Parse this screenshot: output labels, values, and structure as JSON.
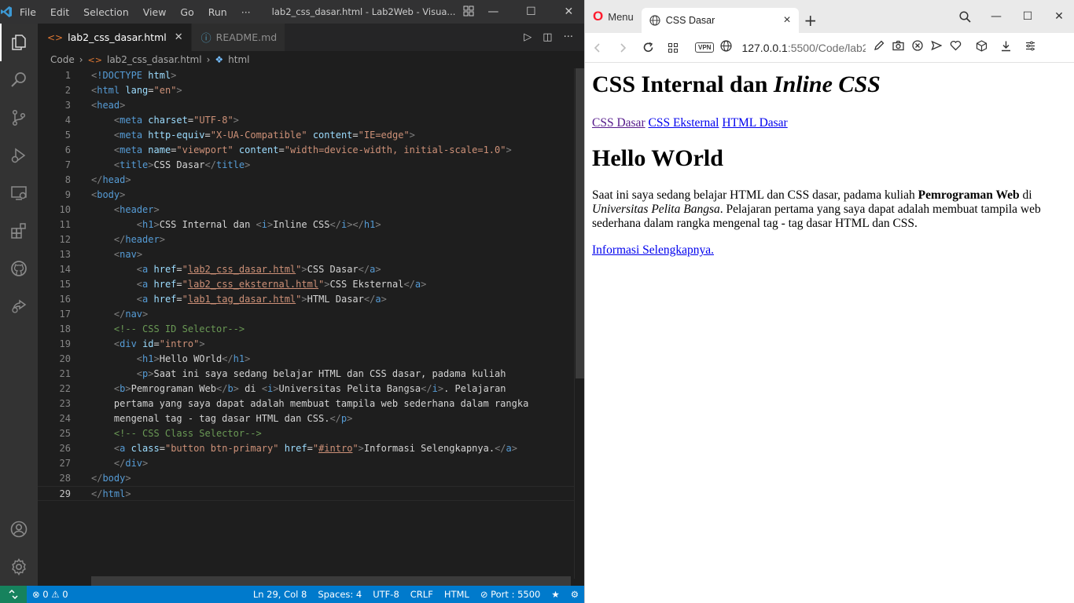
{
  "vscode": {
    "menu": [
      "File",
      "Edit",
      "Selection",
      "View",
      "Go",
      "Run",
      "···"
    ],
    "window_title": "lab2_css_dasar.html - Lab2Web - Visua...",
    "tabs": [
      {
        "label": "lab2_css_dasar.html",
        "active": true
      },
      {
        "label": "README.md",
        "active": false
      }
    ],
    "breadcrumb": [
      "Code",
      "lab2_css_dasar.html",
      "html"
    ],
    "code_lines": [
      [
        [
          "p",
          "<"
        ],
        [
          "t",
          "!DOCTYPE"
        ],
        [
          "x",
          " "
        ],
        [
          "a",
          "html"
        ],
        [
          "p",
          ">"
        ]
      ],
      [
        [
          "p",
          "<"
        ],
        [
          "t",
          "html"
        ],
        [
          "x",
          " "
        ],
        [
          "a",
          "lang"
        ],
        [
          "x",
          "="
        ],
        [
          "s",
          "\"en\""
        ],
        [
          "p",
          ">"
        ]
      ],
      [
        [
          "p",
          "<"
        ],
        [
          "t",
          "head"
        ],
        [
          "p",
          ">"
        ]
      ],
      [
        [
          "x",
          "    "
        ],
        [
          "p",
          "<"
        ],
        [
          "t",
          "meta"
        ],
        [
          "x",
          " "
        ],
        [
          "a",
          "charset"
        ],
        [
          "x",
          "="
        ],
        [
          "s",
          "\"UTF-8\""
        ],
        [
          "p",
          ">"
        ]
      ],
      [
        [
          "x",
          "    "
        ],
        [
          "p",
          "<"
        ],
        [
          "t",
          "meta"
        ],
        [
          "x",
          " "
        ],
        [
          "a",
          "http-equiv"
        ],
        [
          "x",
          "="
        ],
        [
          "s",
          "\"X-UA-Compatible\""
        ],
        [
          "x",
          " "
        ],
        [
          "a",
          "content"
        ],
        [
          "x",
          "="
        ],
        [
          "s",
          "\"IE=edge\""
        ],
        [
          "p",
          ">"
        ]
      ],
      [
        [
          "x",
          "    "
        ],
        [
          "p",
          "<"
        ],
        [
          "t",
          "meta"
        ],
        [
          "x",
          " "
        ],
        [
          "a",
          "name"
        ],
        [
          "x",
          "="
        ],
        [
          "s",
          "\"viewport\""
        ],
        [
          "x",
          " "
        ],
        [
          "a",
          "content"
        ],
        [
          "x",
          "="
        ],
        [
          "s",
          "\"width=device-width, initial-scale=1.0\""
        ],
        [
          "p",
          ">"
        ]
      ],
      [
        [
          "x",
          "    "
        ],
        [
          "p",
          "<"
        ],
        [
          "t",
          "title"
        ],
        [
          "p",
          ">"
        ],
        [
          "x",
          "CSS Dasar"
        ],
        [
          "p",
          "</"
        ],
        [
          "t",
          "title"
        ],
        [
          "p",
          ">"
        ]
      ],
      [
        [
          "p",
          "</"
        ],
        [
          "t",
          "head"
        ],
        [
          "p",
          ">"
        ]
      ],
      [
        [
          "p",
          "<"
        ],
        [
          "t",
          "body"
        ],
        [
          "p",
          ">"
        ]
      ],
      [
        [
          "x",
          "    "
        ],
        [
          "p",
          "<"
        ],
        [
          "t",
          "header"
        ],
        [
          "p",
          ">"
        ]
      ],
      [
        [
          "x",
          "        "
        ],
        [
          "p",
          "<"
        ],
        [
          "t",
          "h1"
        ],
        [
          "p",
          ">"
        ],
        [
          "x",
          "CSS Internal dan "
        ],
        [
          "p",
          "<"
        ],
        [
          "t",
          "i"
        ],
        [
          "p",
          ">"
        ],
        [
          "x",
          "Inline CSS"
        ],
        [
          "p",
          "</"
        ],
        [
          "t",
          "i"
        ],
        [
          "p",
          "></"
        ],
        [
          "t",
          "h1"
        ],
        [
          "p",
          ">"
        ]
      ],
      [
        [
          "x",
          "    "
        ],
        [
          "p",
          "</"
        ],
        [
          "t",
          "header"
        ],
        [
          "p",
          ">"
        ]
      ],
      [
        [
          "x",
          "    "
        ],
        [
          "p",
          "<"
        ],
        [
          "t",
          "nav"
        ],
        [
          "p",
          ">"
        ]
      ],
      [
        [
          "x",
          "        "
        ],
        [
          "p",
          "<"
        ],
        [
          "t",
          "a"
        ],
        [
          "x",
          " "
        ],
        [
          "a",
          "href"
        ],
        [
          "x",
          "="
        ],
        [
          "s",
          "\""
        ],
        [
          "su",
          "lab2_css_dasar.html"
        ],
        [
          "s",
          "\""
        ],
        [
          "p",
          ">"
        ],
        [
          "x",
          "CSS Dasar"
        ],
        [
          "p",
          "</"
        ],
        [
          "t",
          "a"
        ],
        [
          "p",
          ">"
        ]
      ],
      [
        [
          "x",
          "        "
        ],
        [
          "p",
          "<"
        ],
        [
          "t",
          "a"
        ],
        [
          "x",
          " "
        ],
        [
          "a",
          "href"
        ],
        [
          "x",
          "="
        ],
        [
          "s",
          "\""
        ],
        [
          "su",
          "lab2_css_eksternal.html"
        ],
        [
          "s",
          "\""
        ],
        [
          "p",
          ">"
        ],
        [
          "x",
          "CSS Eksternal"
        ],
        [
          "p",
          "</"
        ],
        [
          "t",
          "a"
        ],
        [
          "p",
          ">"
        ]
      ],
      [
        [
          "x",
          "        "
        ],
        [
          "p",
          "<"
        ],
        [
          "t",
          "a"
        ],
        [
          "x",
          " "
        ],
        [
          "a",
          "href"
        ],
        [
          "x",
          "="
        ],
        [
          "s",
          "\""
        ],
        [
          "su",
          "lab1_tag_dasar.html"
        ],
        [
          "s",
          "\""
        ],
        [
          "p",
          ">"
        ],
        [
          "x",
          "HTML Dasar"
        ],
        [
          "p",
          "</"
        ],
        [
          "t",
          "a"
        ],
        [
          "p",
          ">"
        ]
      ],
      [
        [
          "x",
          "    "
        ],
        [
          "p",
          "</"
        ],
        [
          "t",
          "nav"
        ],
        [
          "p",
          ">"
        ]
      ],
      [
        [
          "x",
          "    "
        ],
        [
          "c",
          "<!-- CSS ID Selector-->"
        ]
      ],
      [
        [
          "x",
          "    "
        ],
        [
          "p",
          "<"
        ],
        [
          "t",
          "div"
        ],
        [
          "x",
          " "
        ],
        [
          "a",
          "id"
        ],
        [
          "x",
          "="
        ],
        [
          "s",
          "\"intro\""
        ],
        [
          "p",
          ">"
        ]
      ],
      [
        [
          "x",
          "        "
        ],
        [
          "p",
          "<"
        ],
        [
          "t",
          "h1"
        ],
        [
          "p",
          ">"
        ],
        [
          "x",
          "Hello WOrld"
        ],
        [
          "p",
          "</"
        ],
        [
          "t",
          "h1"
        ],
        [
          "p",
          ">"
        ]
      ],
      [
        [
          "x",
          "        "
        ],
        [
          "p",
          "<"
        ],
        [
          "t",
          "p"
        ],
        [
          "p",
          ">"
        ],
        [
          "x",
          "Saat ini saya sedang belajar HTML dan CSS dasar, padama kuliah"
        ]
      ],
      [
        [
          "x",
          "    "
        ],
        [
          "p",
          "<"
        ],
        [
          "t",
          "b"
        ],
        [
          "p",
          ">"
        ],
        [
          "x",
          "Pemrograman Web"
        ],
        [
          "p",
          "</"
        ],
        [
          "t",
          "b"
        ],
        [
          "p",
          ">"
        ],
        [
          "x",
          " di "
        ],
        [
          "p",
          "<"
        ],
        [
          "t",
          "i"
        ],
        [
          "p",
          ">"
        ],
        [
          "x",
          "Universitas Pelita Bangsa"
        ],
        [
          "p",
          "</"
        ],
        [
          "t",
          "i"
        ],
        [
          "p",
          ">"
        ],
        [
          "x",
          ". Pelajaran"
        ]
      ],
      [
        [
          "x",
          "    pertama yang saya dapat adalah membuat tampila web sederhana dalam rangka"
        ]
      ],
      [
        [
          "x",
          "    mengenal tag - tag dasar HTML dan CSS."
        ],
        [
          "p",
          "</"
        ],
        [
          "t",
          "p"
        ],
        [
          "p",
          ">"
        ]
      ],
      [
        [
          "x",
          "    "
        ],
        [
          "c",
          "<!-- CSS Class Selector-->"
        ]
      ],
      [
        [
          "x",
          "    "
        ],
        [
          "p",
          "<"
        ],
        [
          "t",
          "a"
        ],
        [
          "x",
          " "
        ],
        [
          "a",
          "class"
        ],
        [
          "x",
          "="
        ],
        [
          "s",
          "\"button btn-primary\""
        ],
        [
          "x",
          " "
        ],
        [
          "a",
          "href"
        ],
        [
          "x",
          "="
        ],
        [
          "s",
          "\""
        ],
        [
          "su",
          "#intro"
        ],
        [
          "s",
          "\""
        ],
        [
          "p",
          ">"
        ],
        [
          "x",
          "Informasi Selengkapnya."
        ],
        [
          "p",
          "</"
        ],
        [
          "t",
          "a"
        ],
        [
          "p",
          ">"
        ]
      ],
      [
        [
          "x",
          "    "
        ],
        [
          "p",
          "</"
        ],
        [
          "t",
          "div"
        ],
        [
          "p",
          ">"
        ]
      ],
      [
        [
          "p",
          "</"
        ],
        [
          "t",
          "body"
        ],
        [
          "p",
          ">"
        ]
      ],
      [
        [
          "p",
          "</"
        ],
        [
          "t",
          "html"
        ],
        [
          "p",
          ">"
        ]
      ]
    ],
    "current_line": 29,
    "status": {
      "errors": "0",
      "warnings": "0",
      "position": "Ln 29, Col 8",
      "spaces": "Spaces: 4",
      "encoding": "UTF-8",
      "eol": "CRLF",
      "language": "HTML",
      "port": "Port : 5500"
    },
    "colors": {
      "accent": "#007acc",
      "remote": "#16825d"
    }
  },
  "browser": {
    "menu_label": "Menu",
    "tab_title": "CSS Dasar",
    "vpn_label": "VPN",
    "url_host": "127.0.0.1",
    "url_rest": ":5500/Code/lab2",
    "page": {
      "heading_plain": "CSS Internal dan ",
      "heading_italic": "Inline CSS",
      "nav_links": [
        "CSS Dasar",
        "CSS Eksternal",
        "HTML Dasar"
      ],
      "hello": "Hello WOrld",
      "p_start": "Saat ini saya sedang belajar HTML dan CSS dasar, padama kuliah ",
      "p_bold": "Pemrograman Web",
      "p_di": " di ",
      "p_italic": "Universitas Pelita Bangsa",
      "p_end": ". Pelajaran pertama yang saya dapat adalah membuat tampila web sederhana dalam rangka mengenal tag - tag dasar HTML dan CSS.",
      "more_link": "Informasi Selengkapnya."
    }
  }
}
